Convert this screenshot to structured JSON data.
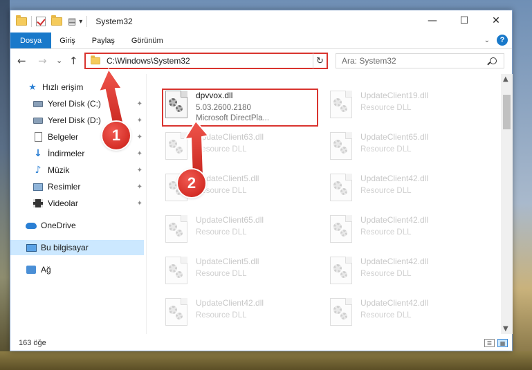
{
  "window": {
    "title": "System32",
    "controls": {
      "minimize": "—",
      "maximize": "☐",
      "close": "✕"
    }
  },
  "ribbon": {
    "tabs": [
      "Dosya",
      "Giriş",
      "Paylaş",
      "Görünüm"
    ],
    "active_tab": "Dosya",
    "help": "?"
  },
  "navigation": {
    "back": "←",
    "forward": "→",
    "recent": "⌄",
    "up": "↑",
    "address": "C:\\Windows\\System32",
    "refresh": "↻",
    "search_placeholder": "Ara: System32"
  },
  "sidebar": {
    "items": [
      {
        "label": "Hızlı erişim",
        "icon": "star-icon",
        "pinned": false
      },
      {
        "label": "Yerel Disk (C:)",
        "icon": "disk-icon",
        "pinned": true
      },
      {
        "label": "Yerel Disk (D:)",
        "icon": "disk-icon",
        "pinned": true
      },
      {
        "label": "Belgeler",
        "icon": "document-icon",
        "pinned": true
      },
      {
        "label": "İndirmeler",
        "icon": "download-icon",
        "pinned": true
      },
      {
        "label": "Müzik",
        "icon": "music-icon",
        "pinned": true
      },
      {
        "label": "Resimler",
        "icon": "picture-icon",
        "pinned": true
      },
      {
        "label": "Videolar",
        "icon": "video-icon",
        "pinned": true
      },
      {
        "label": "OneDrive",
        "icon": "cloud-icon",
        "pinned": false
      },
      {
        "label": "Bu bilgisayar",
        "icon": "computer-icon",
        "pinned": false,
        "selected": true
      },
      {
        "label": "Ağ",
        "icon": "network-icon",
        "pinned": false
      }
    ],
    "pin_glyph": "📌"
  },
  "files": {
    "selected": {
      "name": "dpvvox.dll",
      "version": "5.03.2600.2180",
      "description": "Microsoft DirectPla..."
    },
    "items": [
      {
        "name": "UpdateClient19.dll",
        "type": "Resource DLL"
      },
      {
        "name": "UpdateClient63.dll",
        "type": "Resource DLL"
      },
      {
        "name": "UpdateClient65.dll",
        "type": "Resource DLL"
      },
      {
        "name": "UpdateClient5.dll",
        "type": "Resource DLL"
      },
      {
        "name": "UpdateClient42.dll",
        "type": "Resource DLL"
      },
      {
        "name": "UpdateClient65.dll",
        "type": "Resource DLL"
      },
      {
        "name": "UpdateClient42.dll",
        "type": "Resource DLL"
      },
      {
        "name": "UpdateClient5.dll",
        "type": "Resource DLL"
      },
      {
        "name": "UpdateClient42.dll",
        "type": "Resource DLL"
      },
      {
        "name": "UpdateClient42.dll",
        "type": "Resource DLL"
      },
      {
        "name": "UpdateClient42.dll",
        "type": "Resource DLL"
      }
    ]
  },
  "statusbar": {
    "count": "163 öğe"
  },
  "callouts": [
    "1",
    "2"
  ],
  "colors": {
    "accent": "#1979ca",
    "highlight": "#d9342f",
    "selection": "#cce8ff"
  }
}
